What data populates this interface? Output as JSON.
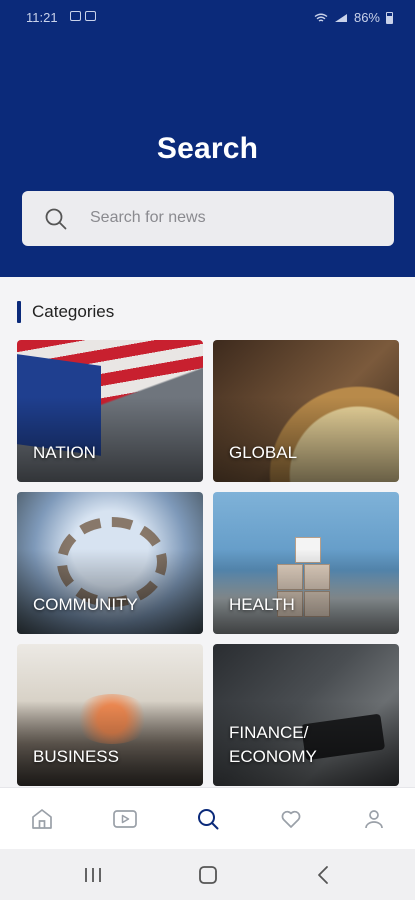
{
  "status_bar": {
    "time": "11:21",
    "battery": "86%"
  },
  "header": {
    "title": "Search",
    "search_placeholder": "Search for news"
  },
  "categories": {
    "heading": "Categories",
    "items": [
      {
        "label": "NATION"
      },
      {
        "label": "GLOBAL"
      },
      {
        "label": "COMMUNITY"
      },
      {
        "label": "HEALTH"
      },
      {
        "label": "BUSINESS"
      },
      {
        "label": "FINANCE/\nECONOMY"
      }
    ]
  },
  "bottom_nav": {
    "items": [
      {
        "icon": "home-icon",
        "active": false
      },
      {
        "icon": "video-icon",
        "active": false
      },
      {
        "icon": "search-icon",
        "active": true
      },
      {
        "icon": "heart-icon",
        "active": false
      },
      {
        "icon": "profile-icon",
        "active": false
      }
    ]
  },
  "colors": {
    "brand": "#0b2a7a",
    "inactive_icon": "#9aa0a8"
  }
}
